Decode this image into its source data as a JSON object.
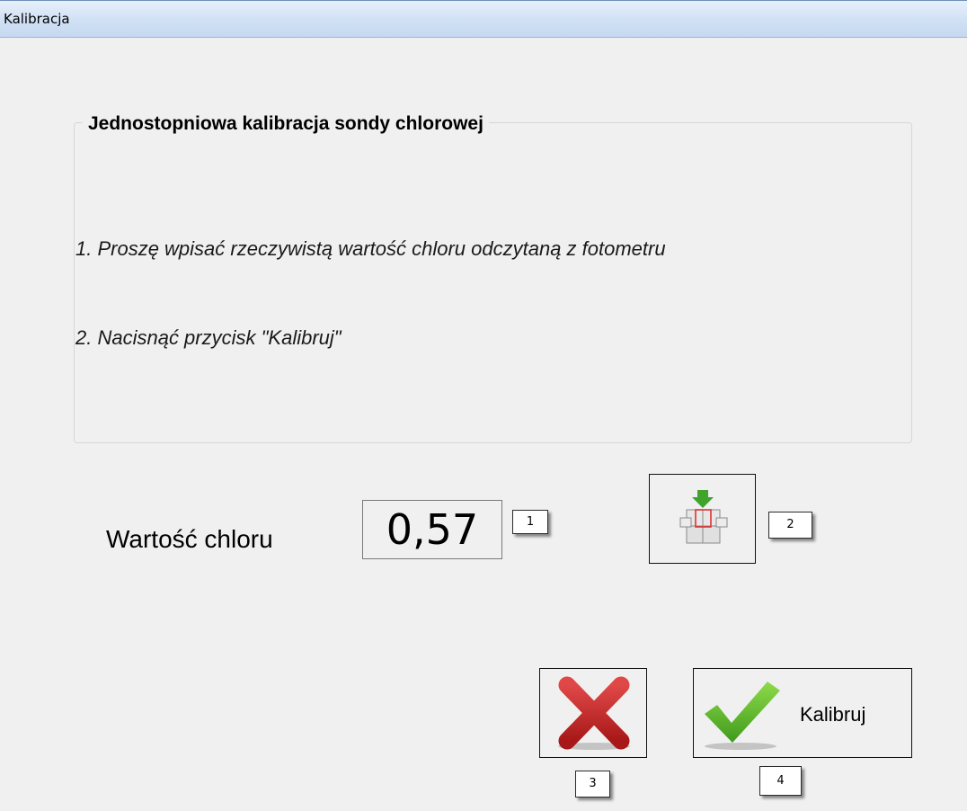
{
  "window": {
    "title": "Kalibracja"
  },
  "group": {
    "title": "Jednostopniowa kalibracja sondy chlorowej",
    "step1": "1. Proszę wpisać rzeczywistą wartość chloru odczytaną z fotometru",
    "step2": "2. Nacisnąć przycisk \"Kalibruj\""
  },
  "value_row": {
    "label": "Wartość chloru",
    "value": "0,57"
  },
  "buttons": {
    "keyboard_icon": "keyboard-icon",
    "cancel_icon": "red-x-icon",
    "calibrate_icon": "green-checkmark-icon",
    "calibrate_label": "Kalibruj"
  },
  "tags": {
    "t1": "1",
    "t2": "2",
    "t3": "3",
    "t4": "4"
  },
  "colors": {
    "cancel": "#c62828",
    "confirm": "#5cb82a",
    "keyboard_arrow": "#3fa32c"
  }
}
